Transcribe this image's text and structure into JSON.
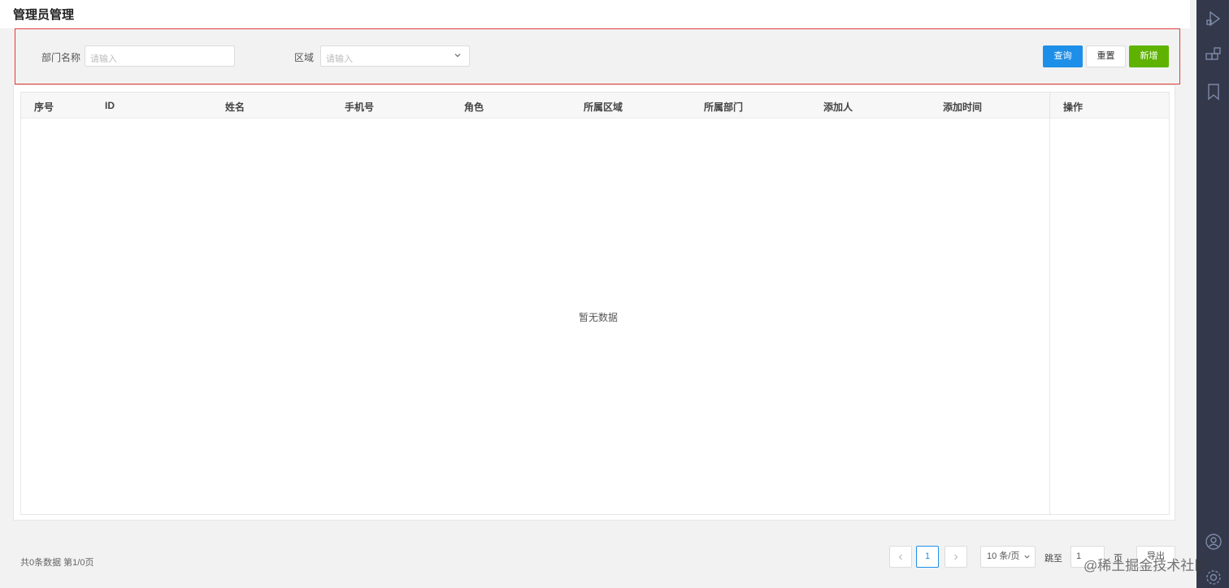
{
  "page": {
    "title": "管理员管理"
  },
  "filters": {
    "dept_label": "部门名称",
    "dept_placeholder": "请输入",
    "region_label": "区域",
    "region_placeholder": "请输入",
    "query_label": "查询",
    "reset_label": "重置",
    "add_label": "新增"
  },
  "table": {
    "columns": [
      "序号",
      "ID",
      "姓名",
      "手机号",
      "角色",
      "所属区域",
      "所属部门",
      "添加人",
      "添加时间"
    ],
    "action_column": "操作",
    "empty_text": "暂无数据"
  },
  "pagination": {
    "summary": "共0条数据 第1/0页",
    "current_page": "1",
    "page_size": "10 条/页",
    "goto_label": "跳至",
    "goto_value": "1",
    "page_unit": "页",
    "confirm_label": "导出"
  },
  "watermark": "@稀土掘金技术社区",
  "colors": {
    "primary": "#1e8fe8",
    "success": "#5fb300",
    "filter_border": "#e43a3a",
    "rail": "#33384a"
  },
  "icons": {
    "prev": "chevron-left-icon",
    "next": "chevron-right-icon",
    "dropdown": "chevron-down-icon",
    "rail": [
      "play-shape-icon",
      "blocks-icon",
      "bookmark-icon",
      "user-icon",
      "settings-icon"
    ]
  }
}
